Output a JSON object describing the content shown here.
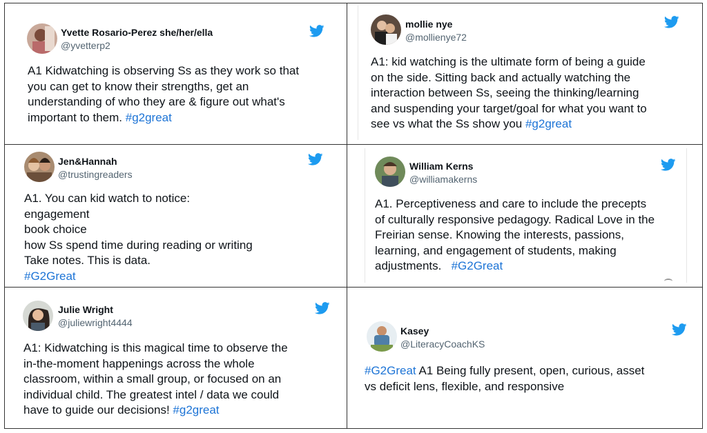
{
  "colors": {
    "hashtag": "#1d74d6",
    "twitter_blue": "#1d9bf0",
    "handle": "#536471",
    "text": "#0f1419"
  },
  "tweets": [
    {
      "id": "t1",
      "name": "Yvette Rosario-Perez she/her/ella",
      "handle": "@yvetterp2",
      "icon": "twitter-bird-icon",
      "lines": [
        {
          "text": "A1 Kidwatching is observing Ss as they work so that"
        },
        {
          "text": "you can get to know their strengths, get an"
        },
        {
          "text": "understanding of who they are & figure out what's"
        },
        {
          "text": "important to them. ",
          "tag": "#g2great"
        }
      ]
    },
    {
      "id": "t2",
      "name": "mollie nye",
      "handle": "@mollienye72",
      "icon": "twitter-bird-icon",
      "lines": [
        {
          "text": "A1: kid watching is the ultimate form of being a guide"
        },
        {
          "text": "on the side. Sitting back and actually watching the"
        },
        {
          "text": "interaction between Ss, seeing the thinking/learning"
        },
        {
          "text": "and suspending your target/goal for what you want to"
        },
        {
          "text": "see vs what the Ss show you ",
          "tag": "#g2great"
        }
      ]
    },
    {
      "id": "t3",
      "name": "Jen&Hannah",
      "handle": "@trustingreaders",
      "icon": "twitter-bird-icon",
      "lines": [
        {
          "text": "A1. You can kid watch to notice:"
        },
        {
          "text": "engagement"
        },
        {
          "text": "book choice"
        },
        {
          "text": "how Ss spend time during reading or writing"
        },
        {
          "text": "Take notes. This is data."
        },
        {
          "text": "",
          "tag": "#G2Great"
        }
      ]
    },
    {
      "id": "t4",
      "name": "William Kerns",
      "handle": "@williamakerns",
      "icon": "twitter-bird-icon",
      "lines": [
        {
          "text": "A1. Perceptiveness and care to include the precepts"
        },
        {
          "text": "of culturally responsive pedagogy. Radical Love in the"
        },
        {
          "text": "Freirian sense. Knowing the interests, passions,"
        },
        {
          "text": "learning, and engagement of students, making"
        },
        {
          "text": "adjustments.   ",
          "tag": "#G2Great"
        }
      ]
    },
    {
      "id": "t5",
      "name": "Julie Wright",
      "handle": "@juliewright4444",
      "icon": "twitter-bird-icon",
      "lines": [
        {
          "text": "A1: Kidwatching is this magical time to observe the"
        },
        {
          "text": "in-the-moment happenings across the whole"
        },
        {
          "text": "classroom, within a small group, or focused on an"
        },
        {
          "text": "individual child. The greatest intel / data we could"
        },
        {
          "text": "have to guide our decisions! ",
          "tag": "#g2great"
        }
      ]
    },
    {
      "id": "t6",
      "name": "Kasey",
      "handle": "@LiteracyCoachKS",
      "icon": "twitter-bird-icon",
      "lines": [
        {
          "lead_tag": "#G2Great",
          "text": " A1 Being fully present, open, curious, asset"
        },
        {
          "text": "vs deficit lens, flexible, and responsive"
        }
      ]
    }
  ]
}
